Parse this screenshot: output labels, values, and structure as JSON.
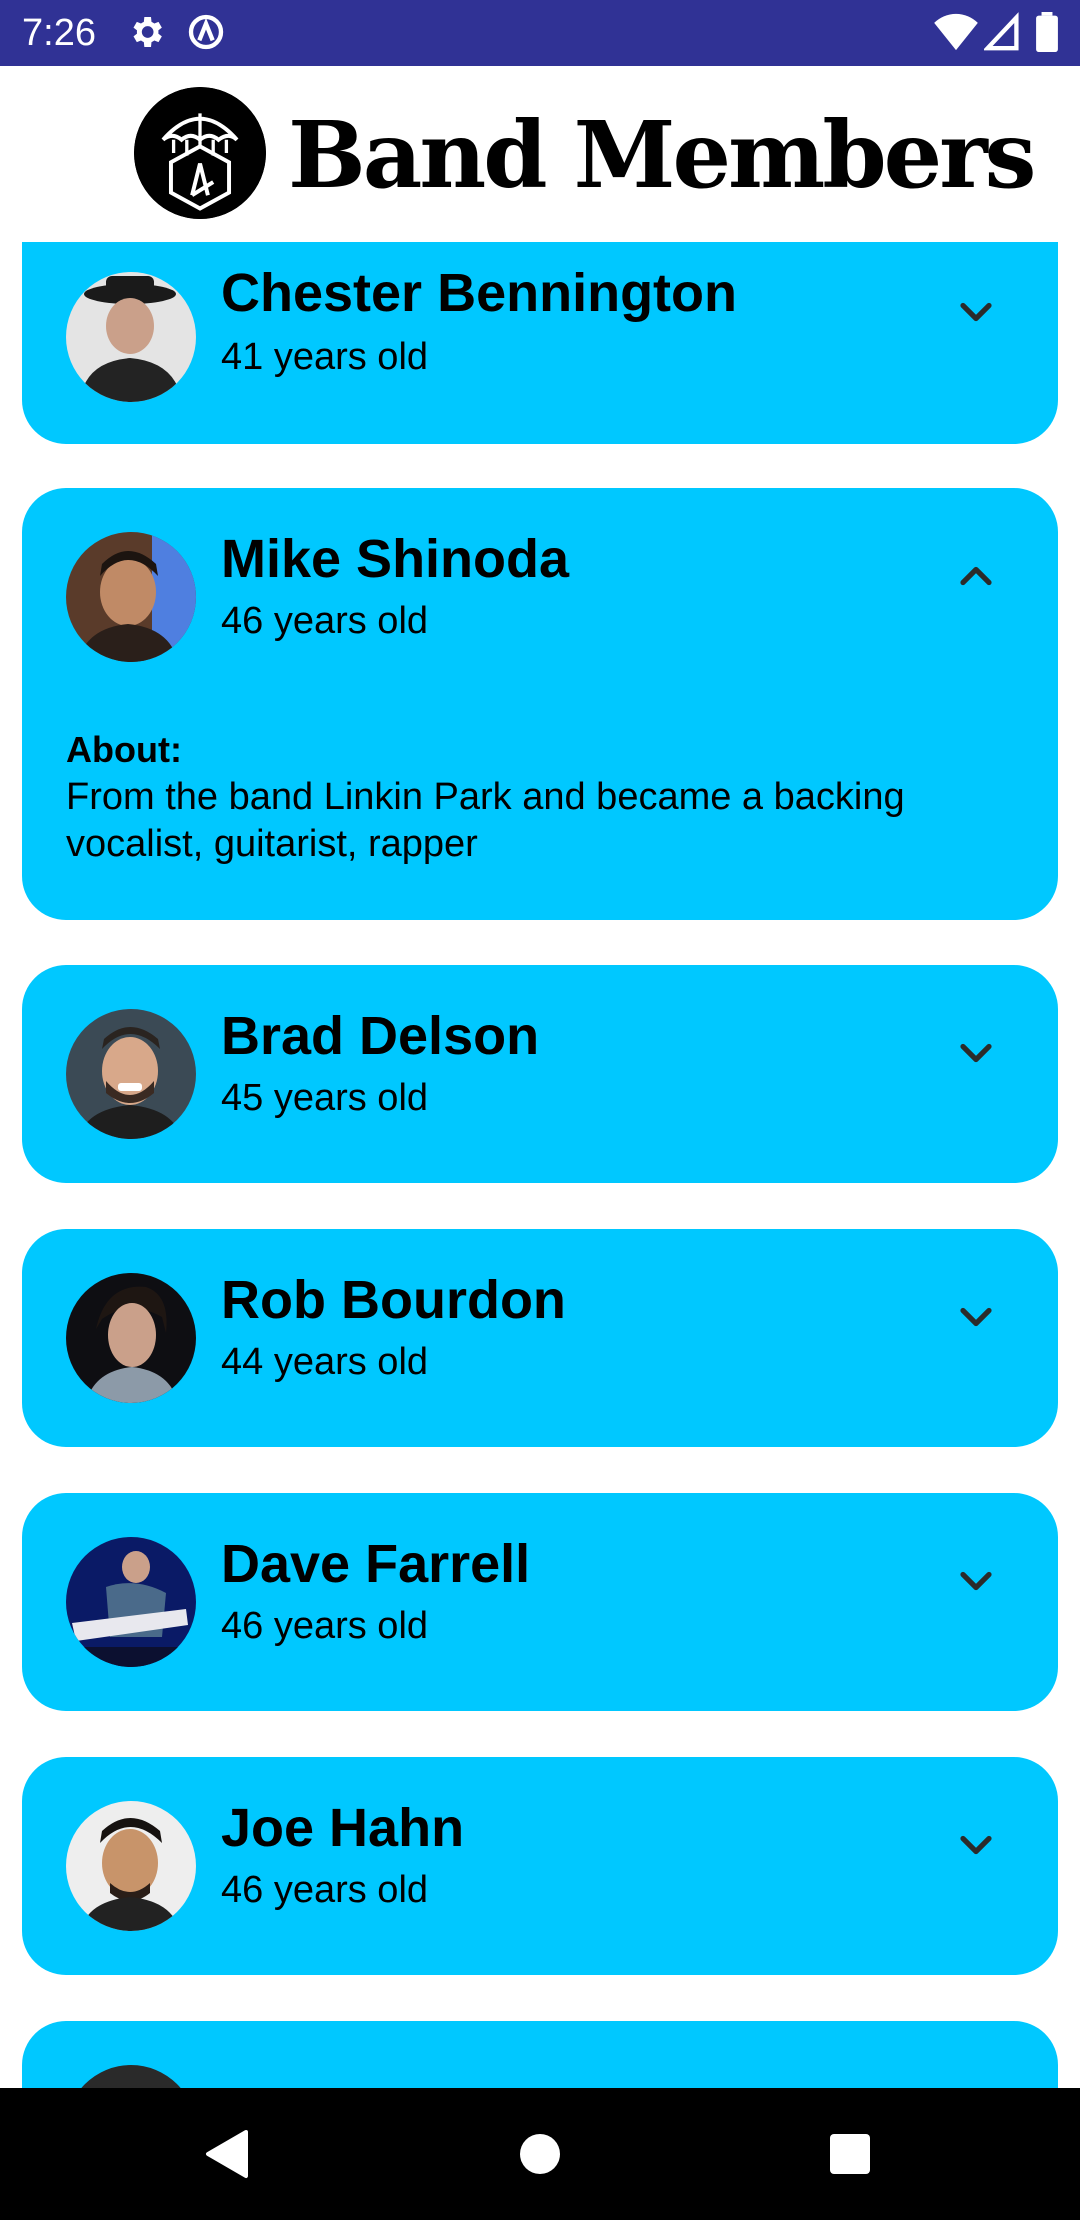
{
  "status_bar": {
    "time": "7:26",
    "icons": [
      "gear-icon",
      "circle-a-icon",
      "wifi-icon",
      "signal-icon",
      "battery-icon"
    ],
    "background": "#303295"
  },
  "header": {
    "title": "Band Members",
    "logo": "umbrella-logo"
  },
  "theme": {
    "card_color": "#00c8ff",
    "text_color": "#000000"
  },
  "members": [
    {
      "name": "Chester Bennington",
      "age": "41 years old",
      "expanded": false,
      "chevron": "chevron-down-icon"
    },
    {
      "name": "Mike Shinoda",
      "age": "46 years old",
      "expanded": true,
      "chevron": "chevron-up-icon",
      "about_label": "About:",
      "about_text": "From the band Linkin Park and became a backing vocalist, guitarist, rapper"
    },
    {
      "name": "Brad Delson",
      "age": "45 years old",
      "expanded": false,
      "chevron": "chevron-down-icon"
    },
    {
      "name": "Rob Bourdon",
      "age": "44 years old",
      "expanded": false,
      "chevron": "chevron-down-icon"
    },
    {
      "name": "Dave Farrell",
      "age": "46 years old",
      "expanded": false,
      "chevron": "chevron-down-icon"
    },
    {
      "name": "Joe Hahn",
      "age": "46 years old",
      "expanded": false,
      "chevron": "chevron-down-icon"
    }
  ],
  "nav_bar": {
    "buttons": [
      "back-icon",
      "home-icon",
      "recents-icon"
    ]
  }
}
